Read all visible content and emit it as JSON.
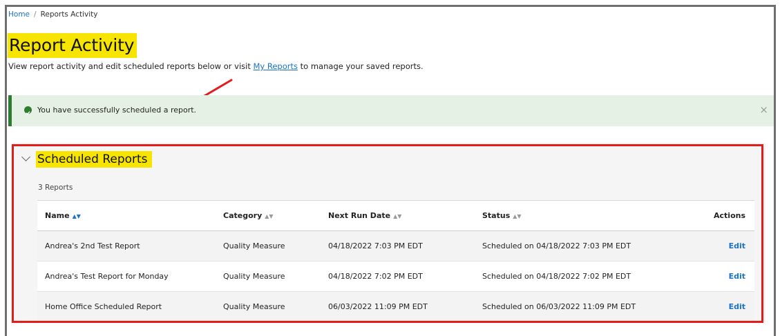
{
  "breadcrumb": {
    "home": "Home",
    "separator": "/",
    "current": "Reports Activity"
  },
  "page": {
    "title": "Report Activity",
    "subtitle_before": "View report activity and edit scheduled reports below or visit ",
    "subtitle_link": "My Reports",
    "subtitle_after": " to manage your saved reports."
  },
  "alert": {
    "message": "You have successfully scheduled a report.",
    "close": "×",
    "icon": "check-circle-icon",
    "color": "#2e7d32"
  },
  "section": {
    "title": "Scheduled Reports",
    "count_label": "3 Reports"
  },
  "table": {
    "headers": {
      "name": "Name",
      "category": "Category",
      "next_run": "Next Run Date",
      "status": "Status",
      "actions": "Actions"
    },
    "rows": [
      {
        "name": "Andrea's 2nd Test Report",
        "category": "Quality Measure",
        "next_run": "04/18/2022  7:03 PM EDT",
        "status": "Scheduled on 04/18/2022  7:03 PM EDT",
        "action": "Edit"
      },
      {
        "name": "Andrea's Test Report for Monday",
        "category": "Quality Measure",
        "next_run": "04/18/2022  7:02 PM EDT",
        "status": "Scheduled on 04/18/2022  7:02 PM EDT",
        "action": "Edit"
      },
      {
        "name": "Home Office Scheduled Report",
        "category": "Quality Measure",
        "next_run": "06/03/2022  11:09 PM EDT",
        "status": "Scheduled on 06/03/2022  11:09 PM EDT",
        "action": "Edit"
      }
    ]
  },
  "colors": {
    "highlight": "#f7e500",
    "annotation_red": "#e21b1b",
    "link": "#1a73c8"
  }
}
